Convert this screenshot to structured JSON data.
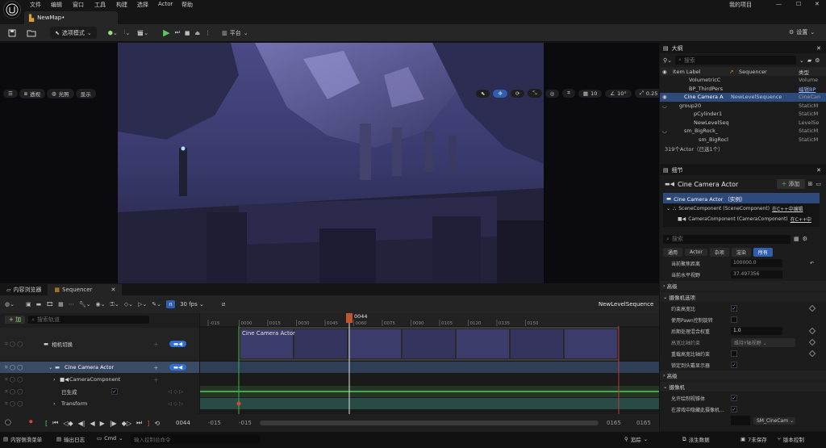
{
  "menu": [
    "文件",
    "编辑",
    "窗口",
    "工具",
    "构建",
    "选择",
    "Actor",
    "帮助"
  ],
  "project_name": "我的项目",
  "map_tab": "NewMap•",
  "toolbar": {
    "select_mode": "选项模式",
    "platform": "平台",
    "settings": "设置"
  },
  "viewport": {
    "perspective": "透视",
    "lit": "光照",
    "show": "显示",
    "grid_size": "10",
    "rotation_snap": "10°",
    "scale_snap": "0.25",
    "camera_speed": "1"
  },
  "outliner": {
    "title": "大纲",
    "search_placeholder": "搜索",
    "col_label": "Item Label",
    "col_sequencer": "Sequencer",
    "col_type": "类型",
    "rows": [
      {
        "name": "VolumetricC",
        "seq": "",
        "type": "Volume"
      },
      {
        "name": "BP_ThirdPers",
        "seq": "",
        "type": "编辑BP"
      },
      {
        "name": "Cine Camera A",
        "seq": "NewLevelSequence",
        "type": "CineCan"
      },
      {
        "name": "group20",
        "seq": "",
        "type": "StaticM"
      },
      {
        "name": "pCylinder1",
        "seq": "",
        "type": "StaticM"
      },
      {
        "name": "NewLevelSeq",
        "seq": "",
        "type": "LevelSe"
      },
      {
        "name": "sm_BigRock_",
        "seq": "",
        "type": "StaticM"
      },
      {
        "name": "sm_BigRocl",
        "seq": "",
        "type": "StaticM"
      }
    ],
    "count_text": "319个Actor（已选1个）"
  },
  "details": {
    "title": "细节",
    "actor_name": "Cine Camera Actor",
    "add_label": "添加",
    "instance_label": "Cine Camera Actor （实例）",
    "components": [
      {
        "name": "SceneComponent (SceneComponent)",
        "link": "在C++中编辑"
      },
      {
        "name": "CameraComponent (CameraComponent)",
        "link": "在C++中"
      }
    ],
    "search_placeholder": "搜索",
    "filter_tabs": [
      "通用",
      "Actor",
      "杂项",
      "渲染",
      "所有"
    ],
    "props": {
      "focus_dist_label": "当前聚焦距离",
      "focus_dist_value": "100000.0",
      "hfov_label": "当前水平视野",
      "hfov_value": "37.497356",
      "advanced1": "高级",
      "camera_options": "摄像机选项",
      "constrain_aspect": "约束高宽比",
      "use_pawn_rotation": "使用Pawn控制旋转",
      "postprocess_weight": "后期处理混合权重",
      "postprocess_weight_value": "1.0",
      "aspect_axis_constraint": "高宽比轴约束",
      "aspect_axis_value": "维持Y轴视野",
      "override_aspect": "重载高宽比轴约束",
      "lock_to_hmd": "锁定到头戴显示器",
      "advanced2": "高级",
      "camera_cat": "摄像机",
      "allow_mesh": "允许绘制视锥体",
      "hide_in_game": "在游戏中隐藏此摄像机...",
      "mesh_value": "SM_CineCam"
    }
  },
  "sequencer": {
    "tab_content": "内容浏览器",
    "tab_sequencer": "Sequencer",
    "fps": "30 fps",
    "sequence_name": "NewLevelSequence",
    "add_label": "+ 加",
    "search_placeholder": "搜索轨道",
    "tracks": {
      "camera_cut": "相机切换",
      "camera_actor": "Cine Camera Actor",
      "camera_component": "CameraComponent",
      "spawned": "已生成",
      "transform": "Transform"
    },
    "ruler_ticks": [
      "-015",
      "0000",
      "0015",
      "0030",
      "0045",
      "0060",
      "0075",
      "0090",
      "0105",
      "0120",
      "0135",
      "0150"
    ],
    "current_frame": "0044",
    "clip_label": "Cine Camera Actor",
    "transport_frame": "0044",
    "range_start_a": "-015",
    "range_start_b": "-015",
    "range_end_a": "0165",
    "range_end_b": "0165"
  },
  "statusbar": {
    "content_drawer": "内容侧滑菜单",
    "output_log": "输出日志",
    "cmd": "Cmd",
    "console_placeholder": "输入控制台命令",
    "trace": "追踪",
    "derived_data": "派生数据",
    "unsaved": "7未保存",
    "source_control": "版本控制"
  }
}
